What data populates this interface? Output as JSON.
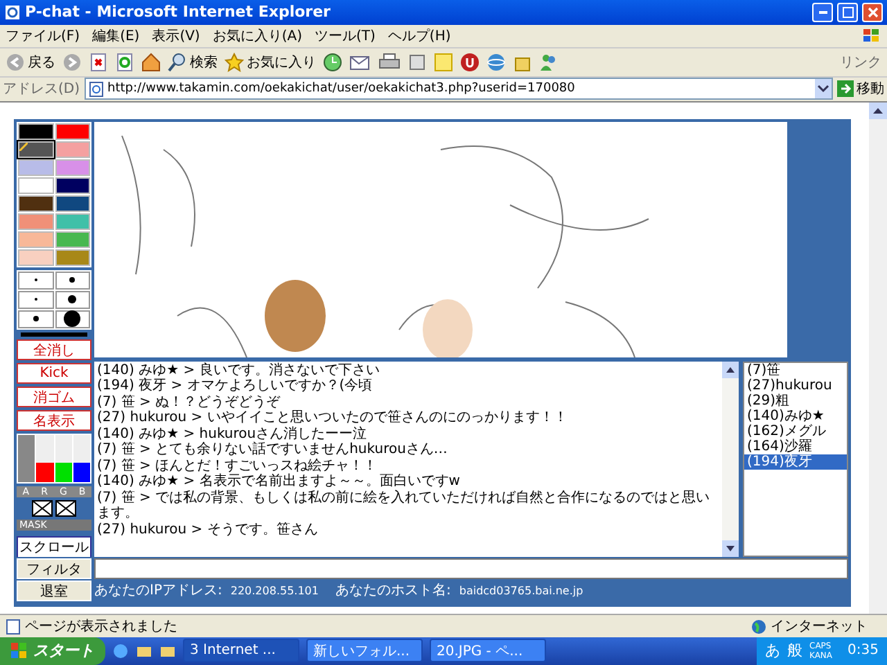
{
  "window": {
    "title": "P-chat - Microsoft Internet Explorer"
  },
  "menu": [
    "ファイル(F)",
    "編集(E)",
    "表示(V)",
    "お気に入り(A)",
    "ツール(T)",
    "ヘルプ(H)"
  ],
  "toolbar": {
    "back": "戻る",
    "search": "検索",
    "favorites": "お気に入り",
    "links": "リンク"
  },
  "address": {
    "label": "アドレス(D)",
    "value": "http://www.takamin.com/oekakichat/user/oekakichat3.php?userid=170080",
    "go": "移動"
  },
  "palette": [
    {
      "color": "#000000",
      "selected": false
    },
    {
      "color": "#ff0000",
      "selected": false
    },
    {
      "color": "#555555",
      "selected": true
    },
    {
      "color": "#f4a0a0",
      "selected": false
    },
    {
      "color": "#b8bce8",
      "selected": false
    },
    {
      "color": "#d890e8",
      "selected": false
    },
    {
      "color": "#ffffff",
      "selected": false
    },
    {
      "color": "#000060",
      "selected": false
    },
    {
      "color": "#503010",
      "selected": false
    },
    {
      "color": "#104880",
      "selected": false
    },
    {
      "color": "#f09078",
      "selected": false
    },
    {
      "color": "#40c0a8",
      "selected": false
    },
    {
      "color": "#f8b898",
      "selected": false
    },
    {
      "color": "#48b850",
      "selected": false
    },
    {
      "color": "#f8d0c0",
      "selected": false
    },
    {
      "color": "#a88818",
      "selected": false
    }
  ],
  "tool_buttons": [
    "全消し",
    "Kick",
    "消ゴム",
    "名表示"
  ],
  "sliders": [
    {
      "label": "A",
      "color": "#888888",
      "level": 1.0
    },
    {
      "label": "R",
      "color": "#ff0000",
      "level": 0.4
    },
    {
      "label": "G",
      "color": "#00e000",
      "level": 0.4
    },
    {
      "label": "B",
      "color": "#0000ff",
      "level": 0.4
    }
  ],
  "mask_label": "MASK",
  "scroll_button": "スクロール",
  "chat": [
    "(140) みゆ★ > 良いです。消さないで下さい",
    "(194) 夜牙 > オマケよろしいですか？(今頃",
    "(7) 笹 > ぬ！？どうぞどうぞ",
    "(27) hukurou > いやイイこと思いついたので笹さんのにのっかります！！",
    "(140) みゆ★ > hukurouさん消したーー泣",
    "(7) 笹 > とても余りない話ですいませんhukurouさん…",
    "(7) 笹 > ほんとだ！すごいっスね絵チャ！！",
    "(140) みゆ★ > 名表示で名前出ますよ～～。面白いですw",
    "(7) 笹 > では私の背景、もしくは私の前に絵を入れていただければ自然と合作になるのではと思います。",
    "(27) hukurou > そうです。笹さん"
  ],
  "users": [
    {
      "name": "(7)笹",
      "selected": false
    },
    {
      "name": "(27)hukurou",
      "selected": false
    },
    {
      "name": "(29)粗",
      "selected": false
    },
    {
      "name": "(140)みゆ★",
      "selected": false
    },
    {
      "name": "(162)メグル",
      "selected": false
    },
    {
      "name": "(164)沙羅",
      "selected": false
    },
    {
      "name": "(194)夜牙",
      "selected": true
    }
  ],
  "filter_button": "フィルタ",
  "exit_button": "退室",
  "ip": {
    "label": "あなたのIPアドレス:",
    "value": "220.208.55.101"
  },
  "host": {
    "label": "あなたのホスト名:",
    "value": "baidcd03765.bai.ne.jp"
  },
  "status_bar": {
    "text": "ページが表示されました",
    "zone": "インターネット"
  },
  "taskbar": {
    "start": "スタート",
    "tasks": [
      "3 Internet ...",
      "新しいフォル...",
      "20.JPG - ペ..."
    ],
    "ime": [
      "あ",
      "般"
    ],
    "caps": "CAPS",
    "kana": "KANA",
    "clock": "0:35"
  }
}
